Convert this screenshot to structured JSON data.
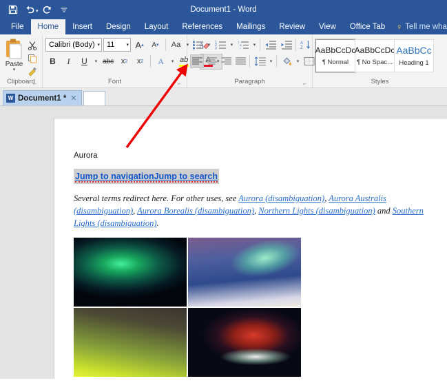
{
  "titlebar": {
    "document_title": "Document1 - Word",
    "quick_access": [
      {
        "name": "save",
        "label": "Save"
      },
      {
        "name": "undo",
        "label": "Undo"
      },
      {
        "name": "redo",
        "label": "Redo"
      },
      {
        "name": "customize",
        "label": "Customize Quick Access Toolbar"
      }
    ],
    "color": "#2b579a"
  },
  "ribbon_tabs": {
    "items": [
      {
        "label": "File"
      },
      {
        "label": "Home"
      },
      {
        "label": "Insert"
      },
      {
        "label": "Design"
      },
      {
        "label": "Layout"
      },
      {
        "label": "References"
      },
      {
        "label": "Mailings"
      },
      {
        "label": "Review"
      },
      {
        "label": "View"
      },
      {
        "label": "Office Tab"
      }
    ],
    "active": "Home",
    "tell_me": "Tell me what yo"
  },
  "ribbon": {
    "clipboard": {
      "group_label": "Clipboard",
      "paste_label": "Paste",
      "cut_label": "Cut",
      "copy_label": "Copy",
      "format_painter_label": "Format Painter"
    },
    "font": {
      "group_label": "Font",
      "font_name": "Calibri (Body)",
      "font_size": "11",
      "grow_font": "A",
      "shrink_font": "A",
      "change_case": "Aa",
      "clear_formatting": "Clear All Formatting",
      "bold": "B",
      "italic": "I",
      "underline": "U",
      "strikethrough": "abc",
      "subscript": "x",
      "superscript": "x",
      "text_effects": "A",
      "highlight": "ab",
      "font_color": "A",
      "font_color_swatch": "#e81123",
      "highlight_swatch": "#ffff00"
    },
    "paragraph": {
      "group_label": "Paragraph",
      "bullets": "Bullets",
      "numbering": "Numbering",
      "multilevel": "Multilevel List",
      "decrease_indent": "Decrease Indent",
      "increase_indent": "Increase Indent",
      "sort": "Sort",
      "show_marks": "¶",
      "align_left": "Align Left",
      "align_center": "Center",
      "align_right": "Align Right",
      "justify": "Justify",
      "line_spacing": "Line and Paragraph Spacing",
      "shading": "Shading",
      "borders": "Borders"
    },
    "styles": {
      "group_label": "Styles",
      "items": [
        {
          "sample": "AaBbCcDc",
          "name": "¶ Normal",
          "selected": true
        },
        {
          "sample": "AaBbCcDc",
          "name": "¶ No Spac...",
          "selected": false
        },
        {
          "sample": "AaBbCc",
          "name": "Heading 1",
          "selected": false
        }
      ]
    }
  },
  "office_tab_bar": {
    "tabs": [
      {
        "label": "Document1 *",
        "close": "✕",
        "active": true
      }
    ],
    "new_tab_label": ""
  },
  "document": {
    "heading": "Aurora",
    "selected_link": "Jump to navigationJump to search",
    "paragraph": {
      "lead": "Several terms redirect here. For other uses, see ",
      "links": [
        "Aurora (disambiguation)",
        "Aurora Australis (disambiguation)",
        "Aurora Borealis (disambiguation)",
        "Northern Lights (disambiguation)",
        "Southern Lights (disambiguation)"
      ],
      "sep": ", ",
      "conj": " and ",
      "end": "."
    },
    "images": [
      {
        "alt": "green aurora over lake"
      },
      {
        "alt": "aurora over snowy road"
      },
      {
        "alt": "yellow-green aurora glow"
      },
      {
        "alt": "red and white aurora"
      }
    ]
  },
  "annotation": {
    "arrow_color": "#ee0000",
    "target": "font-color-dropdown"
  }
}
